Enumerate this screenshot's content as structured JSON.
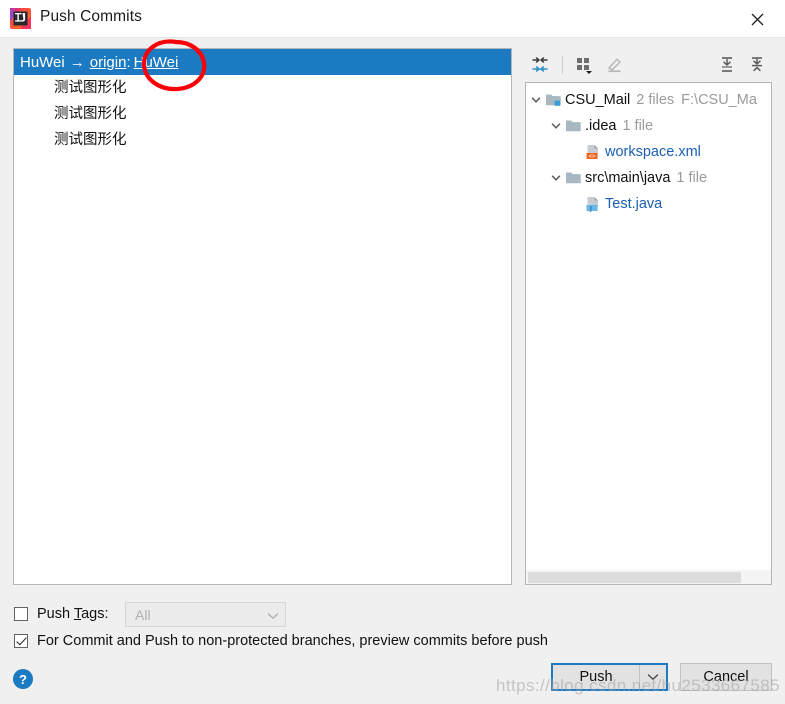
{
  "window": {
    "title": "Push Commits",
    "app_icon": "intellij-idea-icon",
    "close_label": "✕"
  },
  "commits": {
    "branch": {
      "source": "HuWei",
      "arrow": "→",
      "remote": "origin",
      "separator": ":",
      "target": "HuWei"
    },
    "items": [
      {
        "message": "测试图形化"
      },
      {
        "message": "测试图形化"
      },
      {
        "message": "测试图形化"
      }
    ]
  },
  "tree_toolbar": {
    "icons": [
      {
        "name": "collapse-arrows-icon",
        "title": "Collapse"
      },
      {
        "name": "group-by-icon",
        "title": "Group By"
      },
      {
        "name": "edit-pencil-icon",
        "title": "Edit"
      },
      {
        "name": "expand-all-icon",
        "title": "Expand All"
      },
      {
        "name": "collapse-all-icon",
        "title": "Collapse All"
      }
    ]
  },
  "tree": {
    "nodes": [
      {
        "label": "CSU_Mail",
        "meta": "2 files",
        "path": "F:\\CSU_Ma",
        "icon": "module-folder-icon",
        "expanded": true
      },
      {
        "label": ".idea",
        "meta": "1 file",
        "path": "",
        "icon": "folder-icon",
        "expanded": true
      },
      {
        "label": "workspace.xml",
        "meta": "",
        "path": "",
        "icon": "xml-file-icon",
        "expanded": null
      },
      {
        "label": "src\\main\\java",
        "meta": "1 file",
        "path": "",
        "icon": "folder-icon",
        "expanded": true
      },
      {
        "label": "Test.java",
        "meta": "",
        "path": "",
        "icon": "java-file-icon",
        "expanded": null
      }
    ]
  },
  "options": {
    "push_tags": {
      "label_prefix": "Push ",
      "label_mnemonic": "T",
      "label_suffix": "ags:",
      "checked": false,
      "combo_value": "All"
    },
    "preview_commits": {
      "label": "For Commit and Push to non-protected branches, preview commits before push",
      "checked": true
    }
  },
  "footer": {
    "help_label": "?",
    "push_label": "Push",
    "push_dropdown": "chevron-down-icon",
    "cancel_label": "Cancel"
  },
  "watermark": {
    "text": "https://blog.csdn.net/hu2533667585"
  },
  "colors": {
    "selection_blue": "#1b7ac2",
    "link_blue": "#1a5fb4",
    "annotation_red": "#fb0007",
    "muted_gray": "#9b9b9b"
  }
}
